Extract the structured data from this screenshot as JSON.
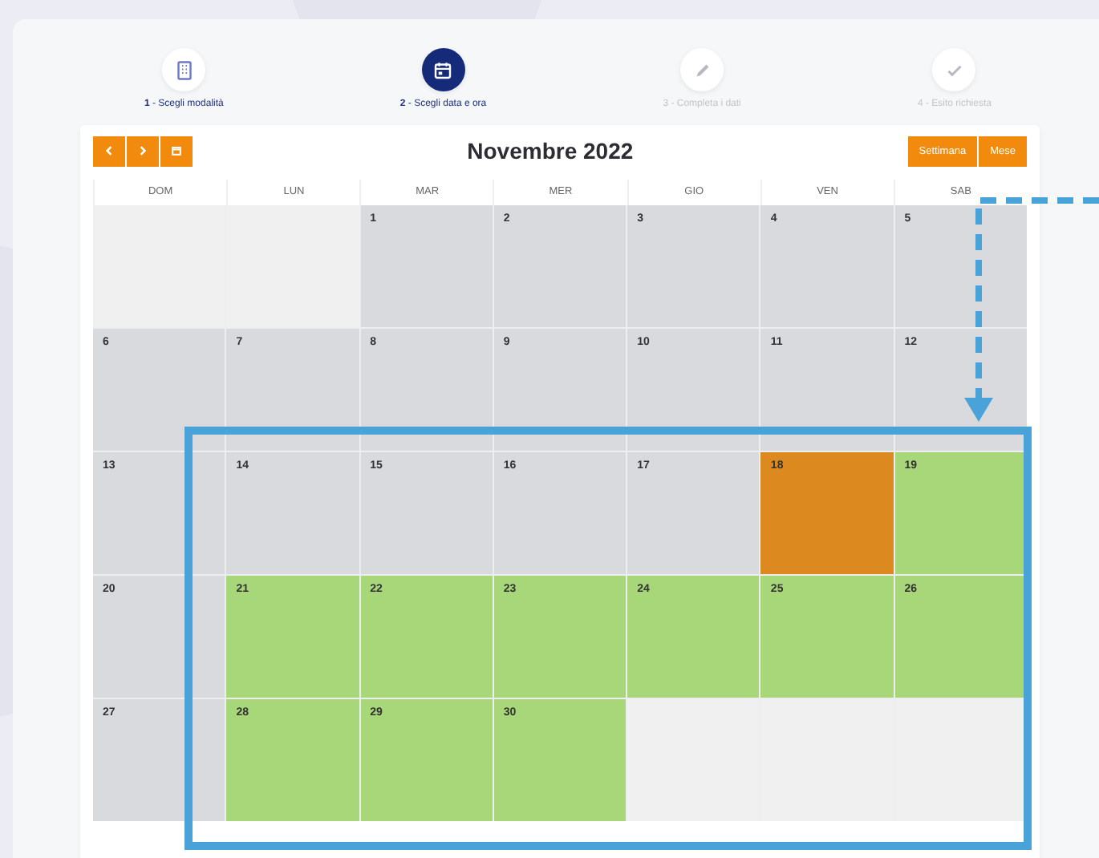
{
  "steps": [
    {
      "label": "**1** - Scegli modalità",
      "selected": false,
      "disabled": false
    },
    {
      "label": "**2** - Scegli data e ora",
      "selected": true,
      "disabled": false
    },
    {
      "label": "3 - Completa i dati",
      "selected": false,
      "disabled": true
    },
    {
      "label": "4 - Esito richiesta",
      "selected": false,
      "disabled": true
    }
  ],
  "calendar": {
    "title": "Novembre 2022",
    "views": [
      "Settimana",
      "Mese"
    ],
    "weekdays": [
      "DOM",
      "LUN",
      "MAR",
      "MER",
      "GIO",
      "VEN",
      "SAB"
    ],
    "days": [
      {
        "kind": "outside"
      },
      {
        "kind": "outside"
      },
      {
        "day": "1",
        "kind": "past"
      },
      {
        "day": "2",
        "kind": "past"
      },
      {
        "day": "3",
        "kind": "past"
      },
      {
        "day": "4",
        "kind": "past"
      },
      {
        "day": "5",
        "kind": "past"
      },
      {
        "day": "6",
        "kind": "past"
      },
      {
        "day": "7",
        "kind": "past"
      },
      {
        "day": "8",
        "kind": "past"
      },
      {
        "day": "9",
        "kind": "past"
      },
      {
        "day": "10",
        "kind": "past"
      },
      {
        "day": "11",
        "kind": "past"
      },
      {
        "day": "12",
        "kind": "past"
      },
      {
        "day": "13",
        "kind": "past"
      },
      {
        "day": "14",
        "kind": "past"
      },
      {
        "day": "15",
        "kind": "past"
      },
      {
        "day": "16",
        "kind": "past"
      },
      {
        "day": "17",
        "kind": "past"
      },
      {
        "day": "18",
        "kind": "today"
      },
      {
        "day": "19",
        "kind": "available"
      },
      {
        "day": "20",
        "kind": "past"
      },
      {
        "day": "21",
        "kind": "available"
      },
      {
        "day": "22",
        "kind": "available"
      },
      {
        "day": "23",
        "kind": "available"
      },
      {
        "day": "24",
        "kind": "available"
      },
      {
        "day": "25",
        "kind": "available"
      },
      {
        "day": "26",
        "kind": "available"
      },
      {
        "day": "27",
        "kind": "past"
      },
      {
        "day": "28",
        "kind": "available"
      },
      {
        "day": "29",
        "kind": "available"
      },
      {
        "day": "30",
        "kind": "available"
      },
      {
        "kind": "outside"
      },
      {
        "kind": "outside"
      },
      {
        "kind": "outside"
      }
    ]
  }
}
